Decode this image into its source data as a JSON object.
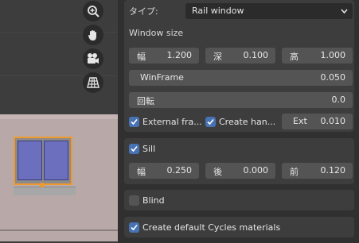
{
  "panel": {
    "type_label": "タイプ:",
    "type_value": "Rail window",
    "window_size_label": "Window size",
    "width_key": "幅",
    "width_value": "1.200",
    "depth_key": "深",
    "depth_value": "0.100",
    "height_key": "高",
    "height_value": "1.000",
    "winframe_label": "WinFrame",
    "winframe_value": "0.050",
    "rotation_label": "回転",
    "rotation_value": "0.0",
    "external_frame_label": "External fra...",
    "create_handle_label": "Create han...",
    "ext_key": "Ext",
    "ext_value": "0.010",
    "sill_label": "Sill",
    "sill_width_key": "幅",
    "sill_width_value": "0.250",
    "sill_back_key": "後",
    "sill_back_value": "0.000",
    "sill_front_key": "前",
    "sill_front_value": "0.120",
    "blind_label": "Blind",
    "cycles_label": "Create default Cycles materials"
  },
  "viewport_tools": [
    "zoom-icon",
    "hand-pan-icon",
    "camera-icon",
    "grid-perspective-icon"
  ],
  "colors": {
    "accent": "#4772b3",
    "selection": "#f09a2d",
    "panel_bg": "#303030",
    "field_bg": "#545454"
  }
}
